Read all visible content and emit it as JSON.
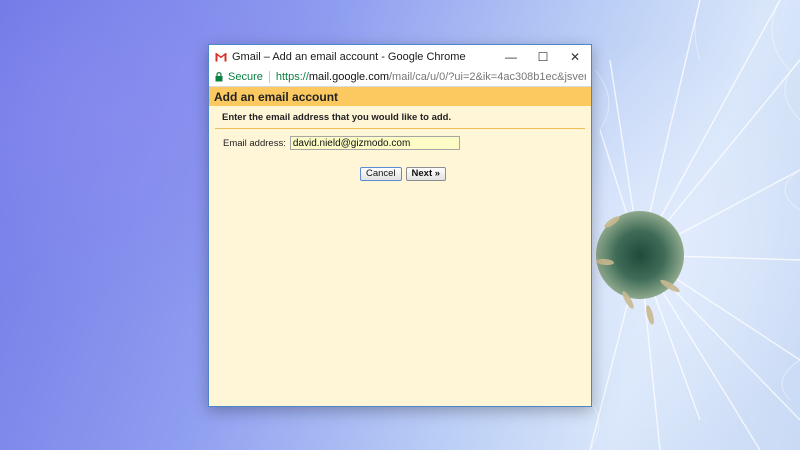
{
  "window": {
    "title": "Gmail – Add an email account - Google Chrome",
    "controls": {
      "minimize": "—",
      "maximize": "☐",
      "close": "✕"
    }
  },
  "addressbar": {
    "secure_label": "Secure",
    "url_scheme": "https://",
    "url_host": "mail.google.com",
    "url_path": "/mail/ca/u/0/?ui=2&ik=4ac308b1ec&jsver=UFIU..."
  },
  "dialog": {
    "heading": "Add an email account",
    "instructions": "Enter the email address that you would like to add.",
    "email_label": "Email address:",
    "email_value": "david.nield@gizmodo.com",
    "cancel_label": "Cancel",
    "next_label": "Next »"
  },
  "colors": {
    "heading_bar": "#fbc95f",
    "content_bg": "#fff6d8",
    "secure_green": "#0b8043",
    "window_border": "#4f86c9"
  }
}
